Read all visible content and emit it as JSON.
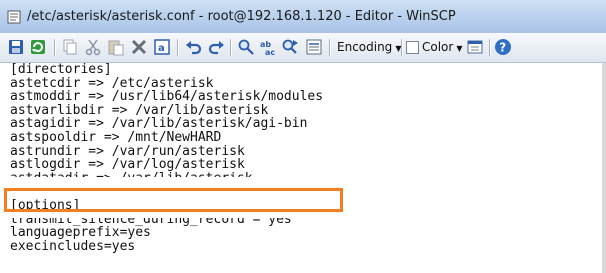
{
  "window": {
    "title": "/etc/asterisk/asterisk.conf - root@192.168.1.120 - Editor - WinSCP",
    "app_icon": "winscp-editor-icon"
  },
  "toolbar": {
    "buttons": [
      {
        "name": "save-icon"
      },
      {
        "name": "reload-icon"
      },
      {
        "name": "copy-icon"
      },
      {
        "name": "cut-icon"
      },
      {
        "name": "paste-icon"
      },
      {
        "name": "delete-icon"
      },
      {
        "name": "select-all-icon"
      },
      {
        "name": "undo-icon"
      },
      {
        "name": "redo-icon"
      },
      {
        "name": "find-icon"
      },
      {
        "name": "replace-icon"
      },
      {
        "name": "find-next-icon"
      },
      {
        "name": "go-to-line-icon"
      },
      {
        "name": "preferences-icon"
      },
      {
        "name": "help-icon"
      }
    ],
    "encoding_label": "Encoding",
    "color_label": "Color"
  },
  "editor": {
    "lines": [
      "[directories]",
      "astetcdir => /etc/asterisk",
      "astmoddir => /usr/lib64/asterisk/modules",
      "astvarlibdir => /var/lib/asterisk",
      "astagidir => /var/lib/asterisk/agi-bin",
      "astspooldir => /mnt/NewHARD",
      "astrundir => /var/run/asterisk",
      "astlogdir => /var/log/asterisk",
      "astdatadir => /var/lib/asterisk",
      "",
      "[options]",
      "transmit_silence_during_record = yes",
      "languageprefix=yes",
      "execincludes=yes"
    ],
    "highlight_color": "#f47f20"
  }
}
